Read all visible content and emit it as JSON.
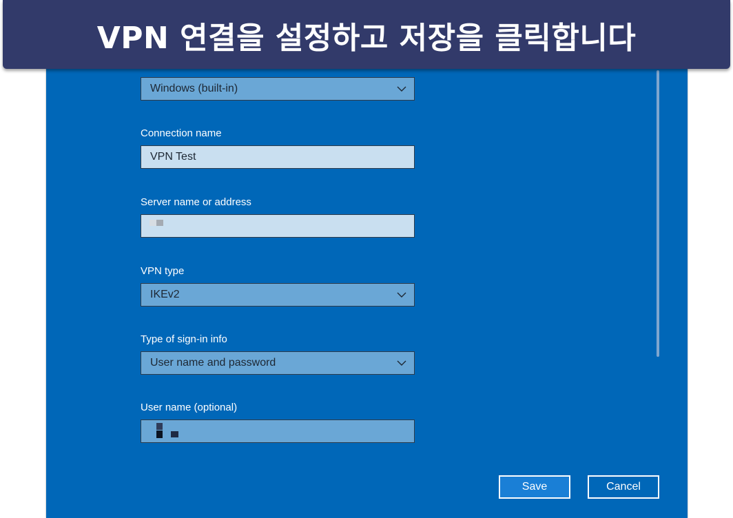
{
  "banner": {
    "text": "VPN 연결을 설정하고 저장을 클릭합니다"
  },
  "form": {
    "vpn_provider": {
      "value": "Windows (built-in)"
    },
    "connection_name": {
      "label": "Connection name",
      "value": "VPN Test"
    },
    "server": {
      "label": "Server name or address",
      "value": ""
    },
    "vpn_type": {
      "label": "VPN type",
      "value": "IKEv2"
    },
    "signin_type": {
      "label": "Type of sign-in info",
      "value": "User name and password"
    },
    "username": {
      "label": "User name (optional)",
      "value": ""
    }
  },
  "buttons": {
    "save": "Save",
    "cancel": "Cancel"
  },
  "colors": {
    "panel": "#0067b8",
    "banner": "#323a6a",
    "field": "#6aa7d6",
    "field_focused": "#c9dff0"
  },
  "icons": {
    "dropdown": "chevron-down-icon"
  }
}
